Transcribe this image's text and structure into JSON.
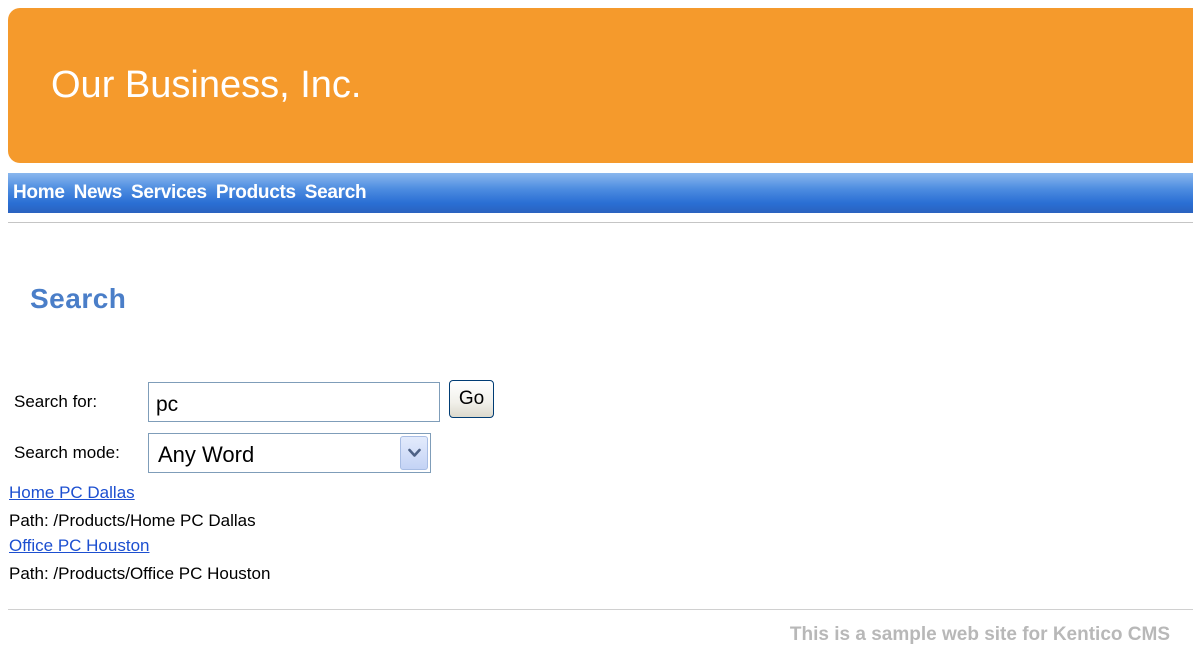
{
  "header": {
    "site_title": "Our Business, Inc.",
    "background_color": "#f59a2c"
  },
  "nav": {
    "items": [
      {
        "label": "Home"
      },
      {
        "label": "News"
      },
      {
        "label": "Services"
      },
      {
        "label": "Products"
      },
      {
        "label": "Search"
      }
    ]
  },
  "main": {
    "page_title": "Search",
    "title_color": "#4a7ec8",
    "search_for_label": "Search for:",
    "search_value": "pc",
    "go_label": "Go",
    "search_mode_label": "Search mode:",
    "search_mode_value": "Any Word",
    "results": [
      {
        "title": "Home PC Dallas",
        "path": "Path: /Products/Home PC Dallas"
      },
      {
        "title": "Office PC Houston",
        "path": "Path: /Products/Office PC Houston"
      }
    ]
  },
  "footer": {
    "text": "This is a sample web site for Kentico CMS"
  }
}
